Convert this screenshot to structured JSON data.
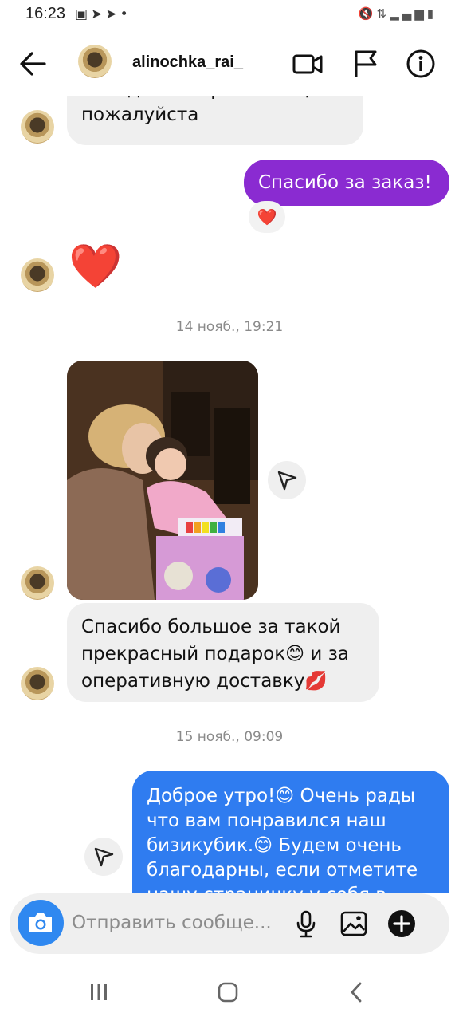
{
  "status_bar": {
    "time": "16:23",
    "left_icons": [
      "gallery-icon",
      "telegram-icon",
      "telegram-icon",
      "dot-icon"
    ],
    "right_icons": [
      "mute-icon",
      "data-icon",
      "signal-icon",
      "battery-icon"
    ]
  },
  "header": {
    "username": "alinochka_rai_",
    "icons": [
      "back-arrow-icon",
      "video-call-icon",
      "flag-icon",
      "info-icon"
    ]
  },
  "messages": {
    "m1_text_line1": "Бизидомик в розовом цвете",
    "m1_text_line2": "пожалуйста",
    "m2_text": "Спасибо за заказ!",
    "m2_reaction": "❤️",
    "m3_emoji": "❤️",
    "timestamp1": "14 нояб., 19:21",
    "m5_line1": "Спасибо большое за такой",
    "m5_line2": "прекрасный подарок😊 и за",
    "m5_line3": "оперативную доставку💋",
    "timestamp2": "15 нояб., 09:09",
    "m6_line1": "Доброе утро!😊 Очень рады",
    "m6_line2": "что вам понравился наш",
    "m6_line3": "бизикубик.😊 Будем очень",
    "m6_line4": "благодарны, если отметите",
    "m6_line5": "нашу страничку у себя в"
  },
  "composer": {
    "placeholder": "Отправить сообще..."
  },
  "colors": {
    "sent_purple": "#8a2bd1",
    "sent_blue": "#2f7cf0",
    "received_bg": "#efefef",
    "camera_blue": "#2f88f0"
  }
}
